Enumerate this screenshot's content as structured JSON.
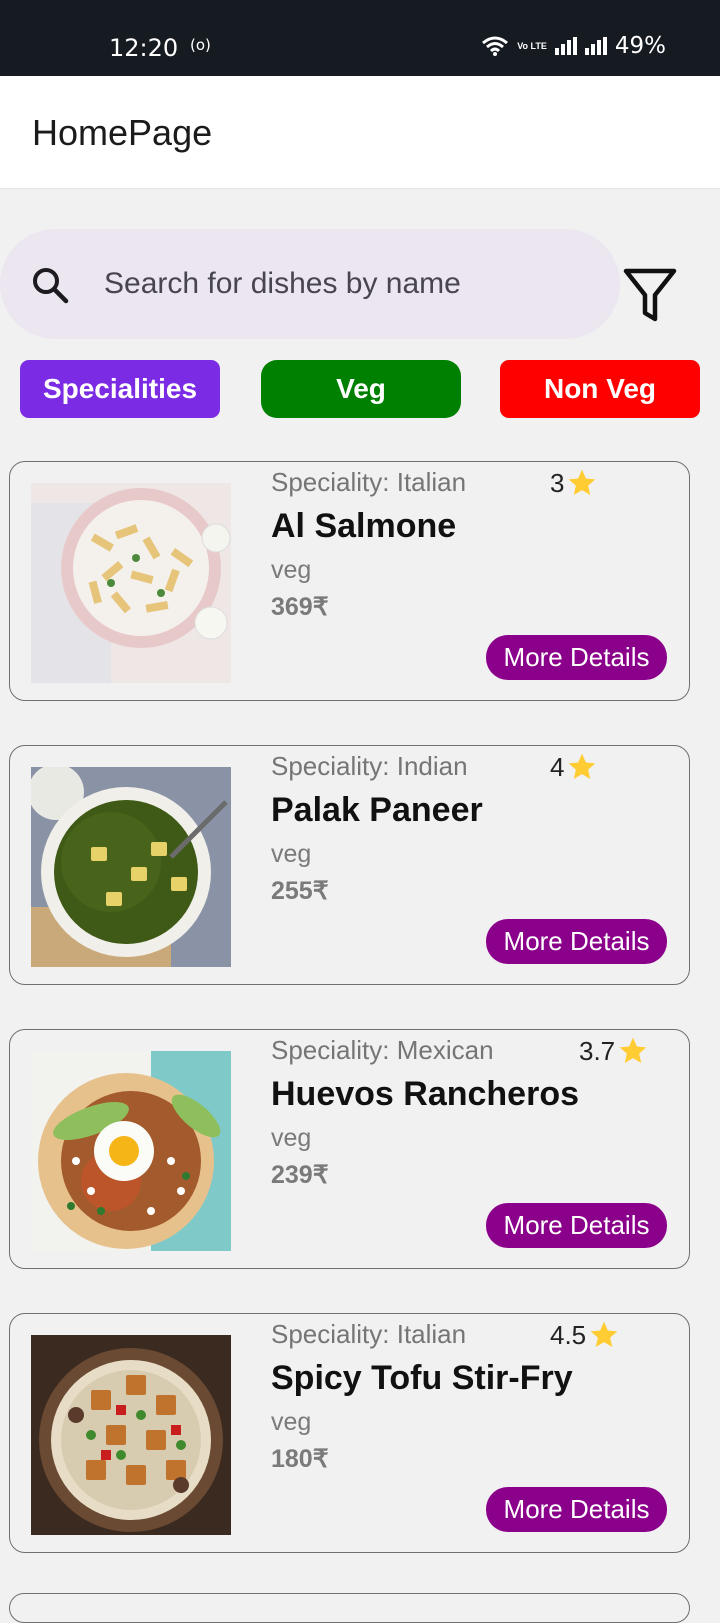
{
  "status_bar": {
    "time": "12:20",
    "nfc": "(o)",
    "volte": "Vo LTE",
    "battery": "49%"
  },
  "app_bar": {
    "title": "HomePage"
  },
  "search": {
    "placeholder": "Search for dishes by name",
    "icon": "search-icon"
  },
  "filter": {
    "icon": "filter-icon"
  },
  "chips": [
    {
      "label": "Specialities",
      "color": "#7b2be3"
    },
    {
      "label": "Veg",
      "color": "#008000"
    },
    {
      "label": "Non Veg",
      "color": "#ff0000"
    }
  ],
  "dishes": [
    {
      "speciality": "Speciality: Italian",
      "rating": "3",
      "name": "Al Salmone",
      "diet": "veg",
      "price": "369₹",
      "button": "More Details"
    },
    {
      "speciality": "Speciality: Indian",
      "rating": "4",
      "name": "Palak Paneer",
      "diet": "veg",
      "price": "255₹",
      "button": "More Details"
    },
    {
      "speciality": "Speciality: Mexican",
      "rating": "3.7",
      "name": "Huevos Rancheros",
      "diet": "veg",
      "price": "239₹",
      "button": "More Details"
    },
    {
      "speciality": "Speciality: Italian",
      "rating": "4.5",
      "name": "Spicy Tofu Stir-Fry",
      "diet": "veg",
      "price": "180₹",
      "button": "More Details"
    }
  ],
  "colors": {
    "more_details": "#8b008b",
    "star": "#ffcc33",
    "search_bg": "#ece6f0"
  }
}
